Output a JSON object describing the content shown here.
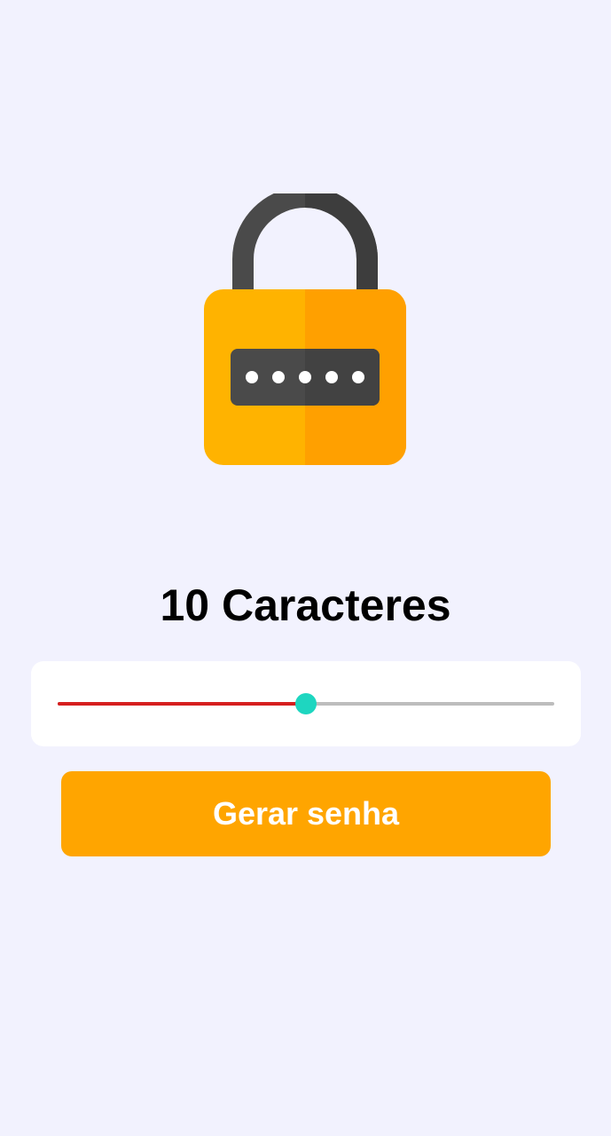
{
  "lock_icon": {
    "name": "padlock-icon",
    "password_mask": "*****",
    "colors": {
      "shackle": "#4a4a4a",
      "body_left": "#ffb300",
      "body_right": "#ffa000",
      "display": "#4a4a4a",
      "dots": "#ffffff"
    }
  },
  "length": {
    "value": 10,
    "label": "10 Caracteres"
  },
  "slider": {
    "fraction": 0.5,
    "colors": {
      "active": "#d61f1f",
      "inactive": "#bdbdbd",
      "thumb": "#1ed6c0"
    }
  },
  "button": {
    "label": "Gerar senha",
    "color": "#ffa500"
  },
  "colors": {
    "background": "#f2f2fe",
    "card": "#ffffff",
    "text": "#000000"
  }
}
